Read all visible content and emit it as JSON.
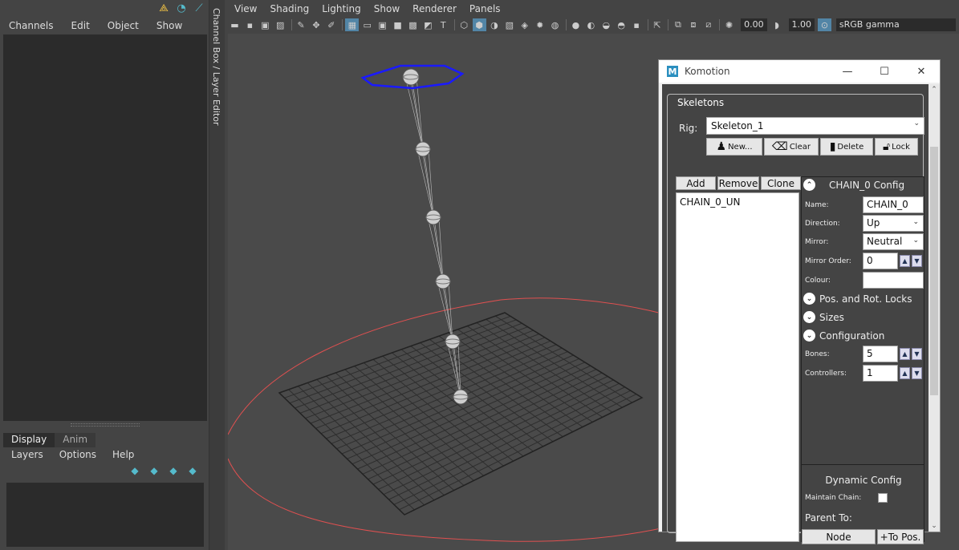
{
  "left_panel": {
    "menu": [
      "Channels",
      "Edit",
      "Object",
      "Show"
    ],
    "top_icons": [
      "axes-icon",
      "loop-icon",
      "edit-icon"
    ]
  },
  "layer_editor": {
    "tabs": [
      "Display",
      "Anim"
    ],
    "active_tab": "Display",
    "menu": [
      "Layers",
      "Options",
      "Help"
    ]
  },
  "vertical_tab": "Channel Box / Layer Editor",
  "viewport": {
    "menu": [
      "View",
      "Shading",
      "Lighting",
      "Show",
      "Renderer",
      "Panels"
    ],
    "toolbar": {
      "exposure": "0.00",
      "gamma": "1.00",
      "color_space": "sRGB gamma"
    }
  },
  "komotion": {
    "title": "Komotion",
    "logo": "M",
    "group_title": "Skeletons",
    "rig_label": "Rig:",
    "rig_value": "Skeleton_1",
    "rig_buttons": [
      "New...",
      "Clear",
      "Delete",
      "Lock"
    ],
    "chain_buttons": [
      "Add",
      "Remove",
      "Clone"
    ],
    "chains": [
      "CHAIN_0_UN"
    ],
    "config": {
      "title": "CHAIN_0 Config",
      "name_label": "Name:",
      "name_value": "CHAIN_0",
      "direction_label": "Direction:",
      "direction_value": "Up",
      "mirror_label": "Mirror:",
      "mirror_value": "Neutral",
      "mirror_order_label": "Mirror Order:",
      "mirror_order_value": "0",
      "colour_label": "Colour:",
      "sections": [
        "Pos. and Rot. Locks",
        "Sizes",
        "Configuration"
      ],
      "bones_label": "Bones:",
      "bones_value": "5",
      "controllers_label": "Controllers:",
      "controllers_value": "1"
    },
    "dynamic": {
      "title": "Dynamic Config",
      "maintain_label": "Maintain Chain:",
      "parent_label": "Parent To:",
      "node_button": "Node",
      "topos_button": "+To Pos."
    }
  },
  "colors": {
    "selection": "#1a1aff",
    "ring": "#e05050",
    "accent": "#5285a6"
  }
}
